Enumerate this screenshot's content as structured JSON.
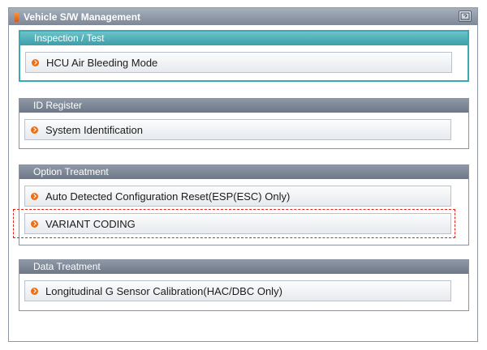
{
  "window": {
    "title": "Vehicle S/W Management"
  },
  "groups": [
    {
      "title": "Inspection / Test",
      "items": [
        {
          "label": "HCU Air Bleeding Mode"
        }
      ]
    },
    {
      "title": "ID Register",
      "items": [
        {
          "label": "System Identification"
        }
      ]
    },
    {
      "title": "Option Treatment",
      "items": [
        {
          "label": "Auto Detected Configuration Reset(ESP(ESC) Only)"
        },
        {
          "label": "VARIANT CODING"
        }
      ]
    },
    {
      "title": "Data Treatment",
      "items": [
        {
          "label": "Longitudinal G Sensor Calibration(HAC/DBC Only)"
        }
      ]
    }
  ],
  "colors": {
    "accent": "#3aa9b3",
    "bullet": "#ee6e12",
    "selection": "#e0241e"
  }
}
